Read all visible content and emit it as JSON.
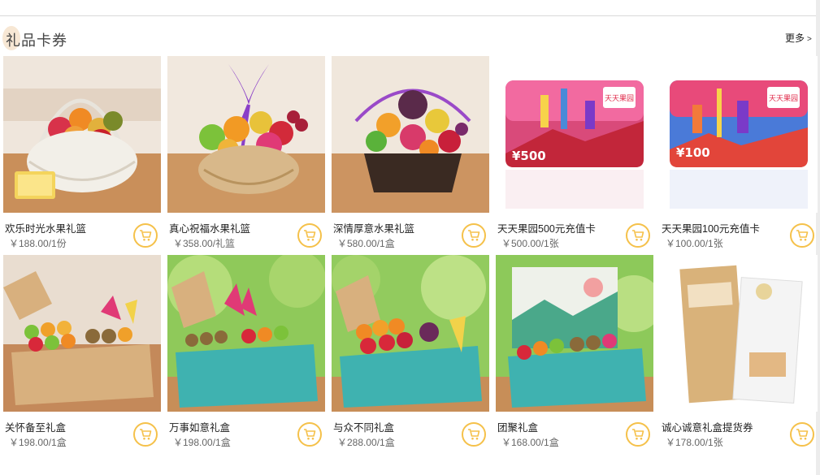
{
  "section": {
    "title": "礼品卡券",
    "more_label": "更多",
    "more_chevron": ">"
  },
  "products": [
    {
      "name": "欢乐时光水果礼篮",
      "price": "￥188.00/1份",
      "image": "fruit-basket-white",
      "card_tag": ""
    },
    {
      "name": "真心祝福水果礼篮",
      "price": "￥358.00/礼篮",
      "image": "fruit-basket-purple-ribbon",
      "card_tag": ""
    },
    {
      "name": "深情厚意水果礼篮",
      "price": "￥580.00/1盒",
      "image": "fruit-basket-dark",
      "card_tag": ""
    },
    {
      "name": "天天果园500元充值卡",
      "price": "￥500.00/1张",
      "image": "gift-card",
      "card_tag": "¥500",
      "card_brand": "天天果园"
    },
    {
      "name": "天天果园100元充值卡",
      "price": "￥100.00/1张",
      "image": "gift-card",
      "card_tag": "¥100",
      "card_brand": "天天果园"
    },
    {
      "name": "关怀备至礼盒",
      "price": "￥198.00/1盒",
      "image": "fruit-box-kraft",
      "card_tag": ""
    },
    {
      "name": "万事如意礼盒",
      "price": "￥198.00/1盒",
      "image": "fruit-box-teal",
      "card_tag": ""
    },
    {
      "name": "与众不同礼盒",
      "price": "￥288.00/1盒",
      "image": "fruit-box-teal",
      "card_tag": ""
    },
    {
      "name": "团聚礼盒",
      "price": "￥168.00/1盒",
      "image": "fruit-box-teal-landscape",
      "card_tag": ""
    },
    {
      "name": "诚心诚意礼盒提货券",
      "price": "￥178.00/1张",
      "image": "gift-voucher",
      "card_tag": ""
    }
  ],
  "colors": {
    "accent": "#f5c14a",
    "wood": "#c98f5a",
    "teal": "#3fb2b0",
    "kraft": "#d8b07e",
    "green_bg": "#8fc95a"
  }
}
